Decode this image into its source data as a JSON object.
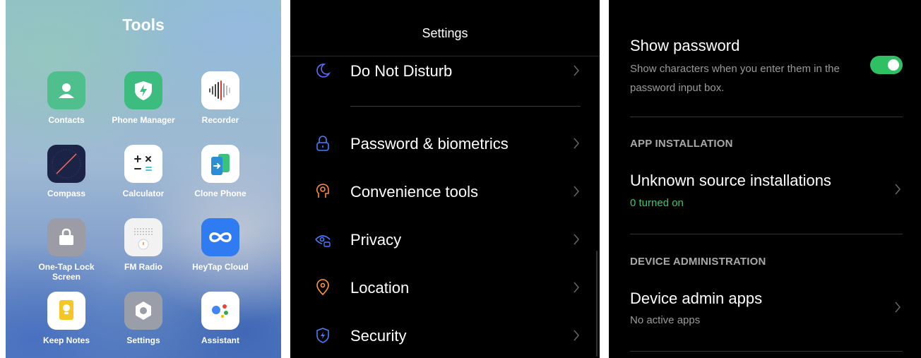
{
  "folder": {
    "title": "Tools",
    "apps": [
      {
        "label": "Contacts",
        "icon": "contacts-icon",
        "color": "#4fc08d"
      },
      {
        "label": "Phone Manager",
        "icon": "phone-manager-icon",
        "color": "#3cbd7f"
      },
      {
        "label": "Recorder",
        "icon": "recorder-icon",
        "color": "#ffffff"
      },
      {
        "label": "Compass",
        "icon": "compass-icon",
        "color": "#1b2346"
      },
      {
        "label": "Calculator",
        "icon": "calculator-icon",
        "color": "#ffffff"
      },
      {
        "label": "Clone Phone",
        "icon": "clone-phone-icon",
        "color": "#ffffff"
      },
      {
        "label": "One-Tap Lock Screen",
        "icon": "lock-icon",
        "color": "#9c9ca6"
      },
      {
        "label": "FM Radio",
        "icon": "radio-icon",
        "color": "#f2f2f2"
      },
      {
        "label": "HeyTap Cloud",
        "icon": "cloud-icon",
        "color": "#2f7bf1"
      },
      {
        "label": "Keep Notes",
        "icon": "notes-icon",
        "color": "#ffffff"
      },
      {
        "label": "Settings",
        "icon": "settings-icon",
        "color": "#9a9ea8"
      },
      {
        "label": "Assistant",
        "icon": "assistant-icon",
        "color": "#ffffff"
      }
    ]
  },
  "settings": {
    "title": "Settings",
    "items": [
      {
        "label": "Do Not Disturb",
        "icon": "moon-icon",
        "color": "#5a6cff"
      },
      {
        "label": "Password & biometrics",
        "icon": "lock-icon",
        "color": "#4a7cff"
      },
      {
        "label": "Convenience tools",
        "icon": "convenience-icon",
        "color": "#ff8a3d"
      },
      {
        "label": "Privacy",
        "icon": "privacy-eye-icon",
        "color": "#4a7cff"
      },
      {
        "label": "Location",
        "icon": "location-pin-icon",
        "color": "#ff9a3d"
      },
      {
        "label": "Security",
        "icon": "shield-icon",
        "color": "#4a7cff"
      }
    ]
  },
  "security": {
    "show_password": {
      "title": "Show password",
      "subtitle": "Show characters when you enter them in the password input box.",
      "toggle_on": true,
      "accent": "#2fc064"
    },
    "app_installation": {
      "heading": "APP INSTALLATION",
      "item_title": "Unknown source installations",
      "item_status": "0 turned on"
    },
    "device_administration": {
      "heading": "DEVICE ADMINISTRATION",
      "item_title": "Device admin apps",
      "item_status": "No active apps"
    }
  }
}
